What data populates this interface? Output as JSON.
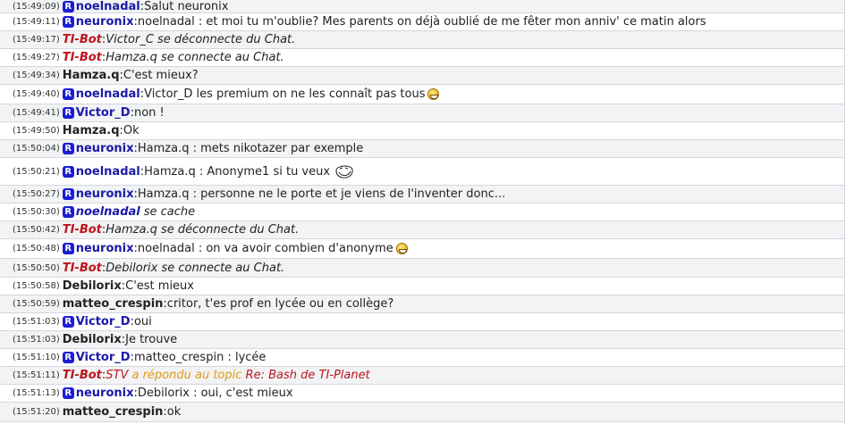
{
  "messages": [
    {
      "time": "(15:49:09)",
      "type": "user",
      "premium": true,
      "nick": "noelnadal",
      "text": "Salut neuronix"
    },
    {
      "time": "(15:49:11)",
      "type": "user",
      "premium": true,
      "nick": "neuronix",
      "text": "noelnadal : et moi tu m'oublie? Mes parents on déjà oublié de me fêter mon anniv' ce matin alors"
    },
    {
      "time": "(15:49:17)",
      "type": "bot",
      "nick": "TI-Bot",
      "text": "Victor_C se déconnecte du Chat."
    },
    {
      "time": "(15:49:27)",
      "type": "bot",
      "nick": "TI-Bot",
      "text": "Hamza.q se connecte au Chat."
    },
    {
      "time": "(15:49:34)",
      "type": "user",
      "premium": false,
      "nick": "Hamza.q",
      "text": "C'est mieux?"
    },
    {
      "time": "(15:49:40)",
      "type": "user",
      "premium": true,
      "nick": "noelnadal",
      "text": "Victor_D les premium on ne les connaît pas tous",
      "emoji": "grin-smiley-icon"
    },
    {
      "time": "(15:49:41)",
      "type": "user",
      "premium": true,
      "nick": "Victor_D",
      "text": "non !"
    },
    {
      "time": "(15:49:50)",
      "type": "user",
      "premium": false,
      "nick": "Hamza.q",
      "text": "Ok"
    },
    {
      "time": "(15:50:04)",
      "type": "user",
      "premium": true,
      "nick": "neuronix",
      "text": "Hamza.q : mets nikotazer par exemple"
    },
    {
      "time": "(15:50:21)",
      "type": "user",
      "premium": true,
      "nick": "noelnadal",
      "text": "Hamza.q : Anonyme1 si tu veux",
      "emoji": "trollface-icon"
    },
    {
      "time": "(15:50:27)",
      "type": "user",
      "premium": true,
      "nick": "neuronix",
      "text": "Hamza.q : personne ne le porte et je viens de l'inventer donc..."
    },
    {
      "time": "(15:50:30)",
      "type": "action",
      "premium": true,
      "nick": "noelnadal",
      "text": "se cache"
    },
    {
      "time": "(15:50:42)",
      "type": "bot",
      "nick": "TI-Bot",
      "text": "Hamza.q se déconnecte du Chat."
    },
    {
      "time": "(15:50:48)",
      "type": "user",
      "premium": true,
      "nick": "neuronix",
      "text": "noelnadal : on va avoir combien d'anonyme",
      "emoji": "grin-smiley-icon"
    },
    {
      "time": "(15:50:50)",
      "type": "bot",
      "nick": "TI-Bot",
      "text": "Debilorix se connecte au Chat."
    },
    {
      "time": "(15:50:58)",
      "type": "user",
      "premium": false,
      "nick": "Debilorix",
      "text": "C'est mieux"
    },
    {
      "time": "(15:50:59)",
      "type": "user",
      "premium": false,
      "nick": "matteo_crespin",
      "text": "critor, t'es prof en lycée ou en collège?"
    },
    {
      "time": "(15:51:03)",
      "type": "user",
      "premium": true,
      "nick": "Victor_D",
      "text": "oui"
    },
    {
      "time": "(15:51:03)",
      "type": "user",
      "premium": false,
      "nick": "Debilorix",
      "text": "Je trouve"
    },
    {
      "time": "(15:51:10)",
      "type": "user",
      "premium": true,
      "nick": "Victor_D",
      "text": "matteo_crespin : lycée"
    },
    {
      "time": "(15:51:11)",
      "type": "botlink",
      "nick": "TI-Bot",
      "who": "STV",
      "mid": " a répondu au topic ",
      "topic": "Re: Bash de TI-Planet"
    },
    {
      "time": "(15:51:13)",
      "type": "user",
      "premium": true,
      "nick": "neuronix",
      "text": "Debilorix : oui, c'est mieux"
    },
    {
      "time": "(15:51:20)",
      "type": "user",
      "premium": false,
      "nick": "matteo_crespin",
      "text": "ok"
    }
  ],
  "premium_badge": "R",
  "separator": ": ",
  "colors": {
    "premium_nick": "#1a1aa8",
    "bot_nick": "#c0141c",
    "badge": "#1c1ed4",
    "orange_text": "#e29a12",
    "row_alt": "#f1f3f5",
    "border": "#d3d7dc"
  }
}
